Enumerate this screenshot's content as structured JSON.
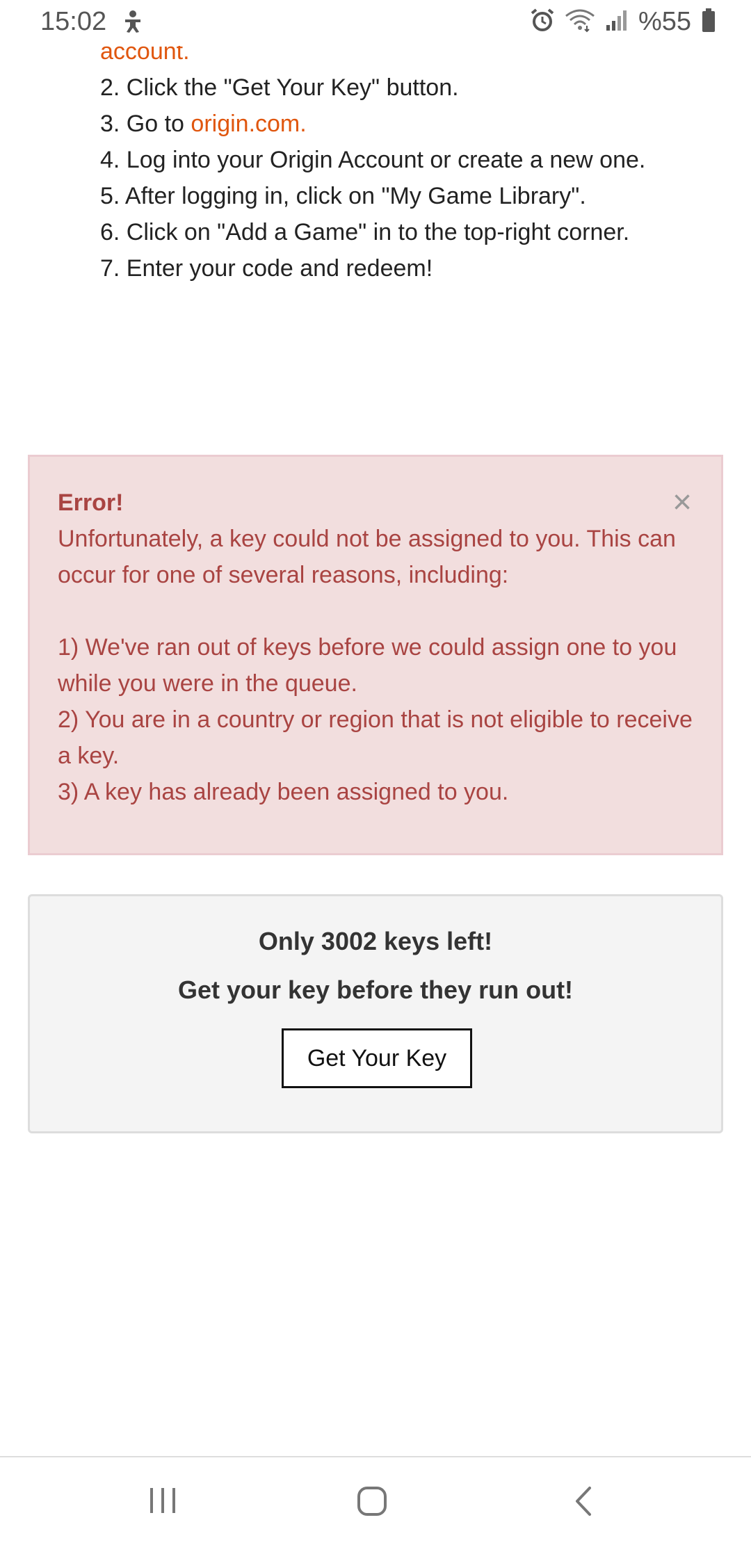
{
  "status_bar": {
    "time": "15:02",
    "battery": "%55",
    "icons": [
      "accessibility-icon",
      "alarm-icon",
      "wifi-icon",
      "signal-icon",
      "battery-icon"
    ]
  },
  "steps": {
    "account_tail": "account.",
    "step2": "2. Click the \"Get Your Key\" button.",
    "step3_prefix": "3. Go to ",
    "step3_link": "origin.com.",
    "step4": "4. Log into your Origin Account or create a new one.",
    "step5": "5. After logging in, click on \"My Game Library\".",
    "step6": "6. Click on \"Add a Game\" in to the top-right corner.",
    "step7": "7. Enter your code and redeem!"
  },
  "alert": {
    "title": "Error!",
    "message": "Unfortunately, a key could not be assigned to you. This can occur for one of several reasons, including:",
    "reason1": "1) We've ran out of keys before we could assign one to you while you were in the queue.",
    "reason2": "2) You are in a country or region that is not eligible to receive a key.",
    "reason3": "3) A key has already been assigned to you.",
    "close": "×"
  },
  "key_box": {
    "keys_left": "Only 3002 keys left!",
    "run_out": "Get your key before they run out!",
    "button_label": "Get Your Key"
  },
  "colors": {
    "link": "#e0560e",
    "alert_bg": "#f2dede",
    "alert_text": "#a94442",
    "alert_border": "#ebccd1",
    "key_box_bg": "#f4f4f4"
  },
  "nav_bar": {
    "icons": [
      "recent-apps-icon",
      "home-icon",
      "back-icon"
    ]
  }
}
